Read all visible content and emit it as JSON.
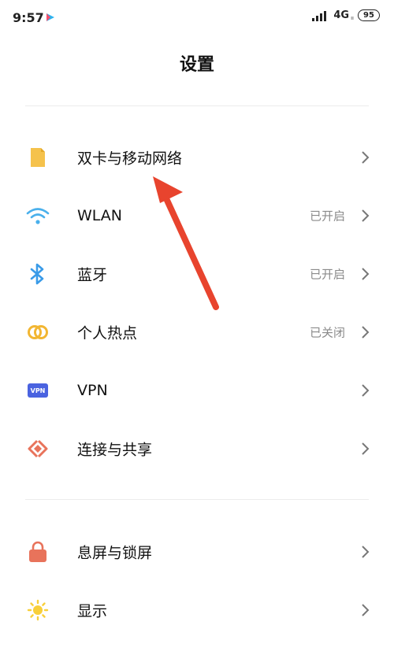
{
  "status_bar": {
    "time": "9:57",
    "network": "4G",
    "network_sub": "ıı",
    "battery": "95"
  },
  "page": {
    "title": "设置"
  },
  "sections": [
    {
      "items": [
        {
          "label": "双卡与移动网络",
          "value": "",
          "icon": "sim-card-icon"
        },
        {
          "label": "WLAN",
          "value": "已开启",
          "icon": "wifi-icon"
        },
        {
          "label": "蓝牙",
          "value": "已开启",
          "icon": "bluetooth-icon"
        },
        {
          "label": "个人热点",
          "value": "已关闭",
          "icon": "hotspot-icon"
        },
        {
          "label": "VPN",
          "value": "",
          "icon": "vpn-icon",
          "icon_text": "VPN"
        },
        {
          "label": "连接与共享",
          "value": "",
          "icon": "connection-share-icon"
        }
      ]
    },
    {
      "items": [
        {
          "label": "息屏与锁屏",
          "value": "",
          "icon": "lock-icon"
        },
        {
          "label": "显示",
          "value": "",
          "icon": "display-sun-icon"
        }
      ]
    }
  ],
  "colors": {
    "sim": "#F5C24C",
    "wifi": "#4AB0EC",
    "bluetooth": "#3A9BE8",
    "hotspot": "#F2B632",
    "vpn": "#4A63E0",
    "connection": "#E8735B",
    "lock": "#E8735B",
    "display": "#F8CF3A",
    "annotation_arrow": "#E8442E"
  }
}
